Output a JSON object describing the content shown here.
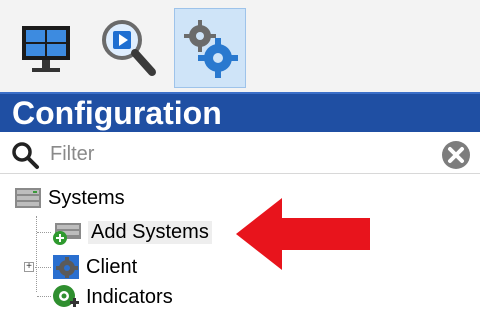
{
  "toolbar": {
    "buttons": [
      {
        "icon": "monitor-grid-icon"
      },
      {
        "icon": "search-play-icon"
      },
      {
        "icon": "gears-icon",
        "active": true
      }
    ]
  },
  "header": {
    "title": "Configuration"
  },
  "filter": {
    "placeholder": "Filter",
    "value": "",
    "clear_icon": "clear-icon"
  },
  "tree": {
    "root": {
      "label": "Systems",
      "icon": "server-icon"
    },
    "children": [
      {
        "label": "Add Systems",
        "icon": "add-server-icon",
        "selected": true
      },
      {
        "label": "Client",
        "icon": "client-gear-icon",
        "expandable": true
      },
      {
        "label": "Indicators",
        "icon": "add-indicator-icon"
      }
    ]
  },
  "annotation": {
    "arrow_color": "#e8141c"
  },
  "colors": {
    "header_bg": "#1f4fa3",
    "active_button_bg": "#cfe4f8"
  }
}
